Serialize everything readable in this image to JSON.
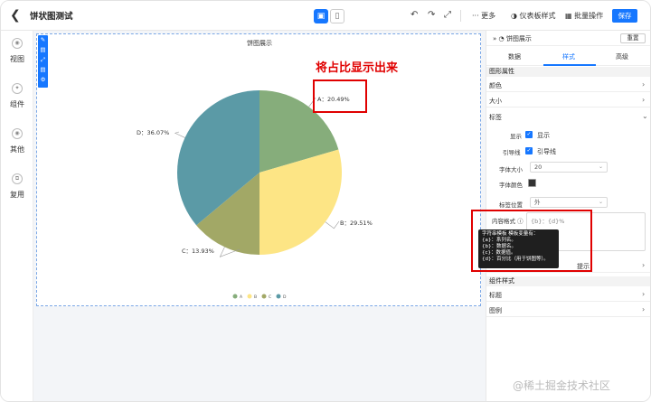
{
  "header": {
    "title": "饼状图测试",
    "more_label": "更多",
    "dashboard_style_label": "仪表板样式",
    "batch_label": "批量操作",
    "save_label": "保存"
  },
  "left_nav": {
    "items": [
      {
        "label": "视图",
        "icon": "view-icon"
      },
      {
        "label": "组件",
        "icon": "component-icon"
      },
      {
        "label": "其他",
        "icon": "other-icon"
      },
      {
        "label": "复用",
        "icon": "reuse-icon"
      }
    ]
  },
  "canvas": {
    "annotation": "将占比显示出来",
    "pie_labels": {
      "A": "A：20.49%",
      "B": "B：29.51%",
      "C": "C：13.93%",
      "D": "D：36.07%"
    },
    "legend": [
      "A",
      "B",
      "C",
      "D"
    ]
  },
  "chart_data": {
    "type": "pie",
    "title": "饼图展示",
    "categories": [
      "A",
      "B",
      "C",
      "D"
    ],
    "values": [
      20.49,
      29.51,
      13.93,
      36.07
    ],
    "colors": [
      "#86ad7b",
      "#fde585",
      "#a2a866",
      "#5b9aa6"
    ],
    "legend_placement": "bottom"
  },
  "panel": {
    "title": "饼图展示",
    "reset_label": "重置",
    "tabs": [
      {
        "label": "数据"
      },
      {
        "label": "样式"
      },
      {
        "label": "高级"
      }
    ],
    "graph_attr_title": "图形属性",
    "rows": {
      "color": "颜色",
      "size": "大小",
      "label": "标签",
      "tooltip": "提示",
      "title": "标题",
      "legend": "图例"
    },
    "component_style_title": "组件样式",
    "label_settings": {
      "show_label": "显示",
      "show_value": "显示",
      "guide_label": "引导线",
      "guide_value": "引导线",
      "font_size_label": "字体大小",
      "font_size_value": "20",
      "font_color_label": "字体颜色",
      "position_label": "标签位置",
      "position_value": "外",
      "format_label": "内容格式",
      "format_value": "{b}：{d}%"
    },
    "tooltip_lines": [
      "字符串模板 模板变量有：",
      "{a}：系列名。",
      "{b}：数据名。",
      "{c}：数据值。",
      "{d}：百分比（用于饼图等）。"
    ]
  },
  "watermark": "@稀土掘金技术社区"
}
